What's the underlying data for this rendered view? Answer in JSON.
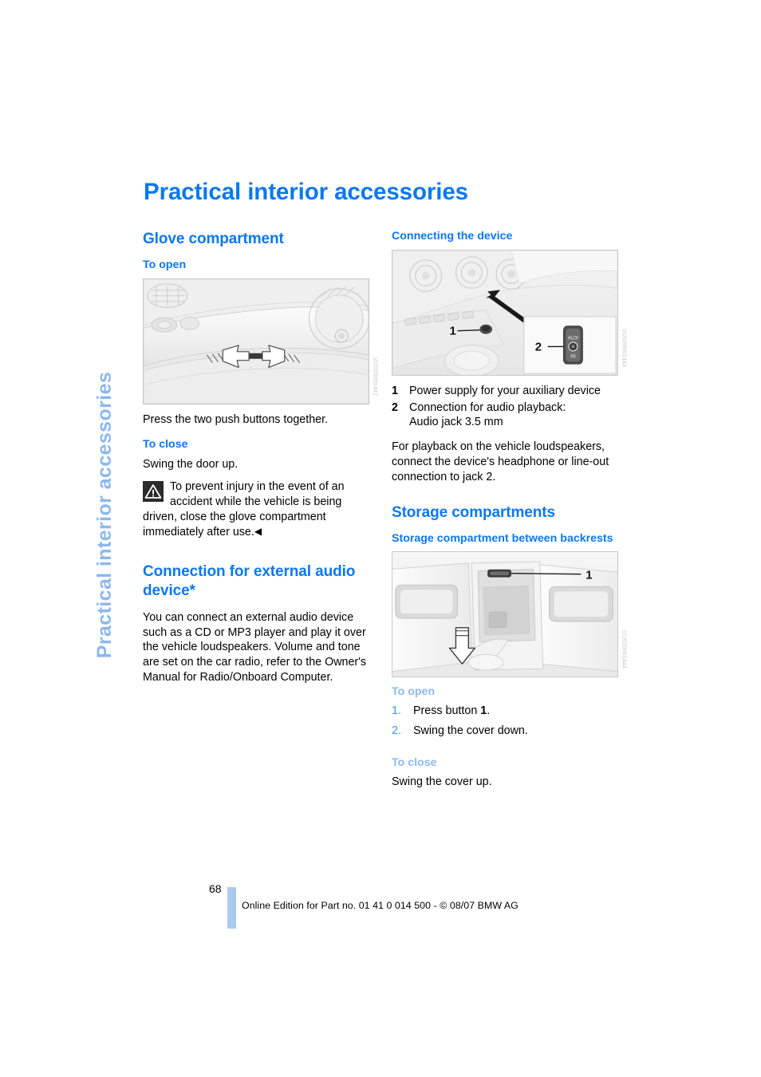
{
  "document": {
    "side_tab_label": "Practical interior accessories",
    "page_title": "Practical interior accessories",
    "page_number": "68",
    "footer_text": "Online Edition for Part no. 01 41 0 014 500 - © 08/07 BMW AG"
  },
  "colors": {
    "heading_blue": "#0a78f0",
    "light_blue": "#8cb8ee",
    "step_number_blue": "#3e93f2",
    "footer_bar_blue": "#a9cbf3"
  },
  "left_column": {
    "glove": {
      "heading": "Glove compartment",
      "to_open_heading": "To open",
      "figure_code": "VI2020001442",
      "open_text": "Press the two push buttons together.",
      "to_close_heading": "To close",
      "close_text": "Swing the door up.",
      "warning_text": "To prevent injury in the event of an accident while the vehicle is being driven, close the glove compartment immediately after use.",
      "warning_endmark": "◀"
    },
    "audio": {
      "heading": "Connection for external audio device*",
      "body": "You can connect an external audio device such as a CD or MP3 player and play it over the vehicle loudspeakers. Volume and tone are set on the car radio, refer to the Owner's Manual for Radio/Onboard Computer."
    }
  },
  "right_column": {
    "connecting": {
      "heading": "Connecting the device",
      "figure_code": "VI2020001443",
      "legend": [
        {
          "num": "1",
          "lines": [
            "Power supply for your auxiliary device"
          ]
        },
        {
          "num": "2",
          "lines": [
            "Connection for audio playback:",
            "Audio jack 3.5 mm"
          ]
        }
      ],
      "body": "For playback on the vehicle loudspeakers, connect the device's headphone or line-out connection to jack 2."
    },
    "storage": {
      "heading": "Storage compartments",
      "subheading": "Storage compartment between backrests",
      "figure_code": "VI2020001444",
      "to_open_heading": "To open",
      "steps": [
        {
          "marker": "1.",
          "text_before": "Press button ",
          "bold": "1",
          "text_after": "."
        },
        {
          "marker": "2.",
          "text_before": "Swing the cover down.",
          "bold": "",
          "text_after": ""
        }
      ],
      "to_close_heading": "To close",
      "close_text": "Swing the cover up."
    }
  },
  "figures": {
    "glove_compartment": {
      "name": "glove-compartment-illustration",
      "callouts": []
    },
    "connecting_device": {
      "name": "center-console-aux-illustration",
      "callouts": [
        "1",
        "2"
      ]
    },
    "backrest_storage": {
      "name": "backrest-storage-illustration",
      "callouts": [
        "1"
      ]
    }
  }
}
